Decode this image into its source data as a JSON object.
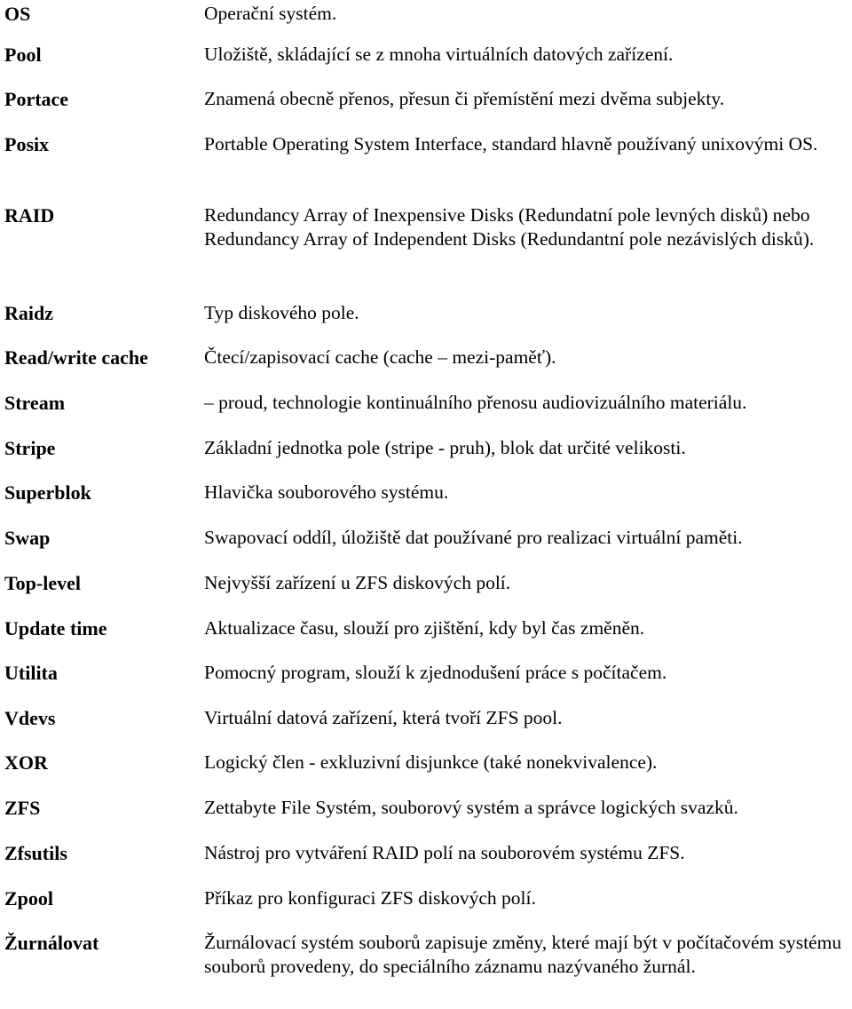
{
  "glossary": {
    "entries": [
      {
        "term": "OS",
        "definition": "Operační systém."
      },
      {
        "term": "Pool",
        "definition": "Uložiště, skládající se z mnoha virtuálních datových zařízení."
      },
      {
        "term": "Portace",
        "definition": "Znamená obecně přenos, přesun či přemístění mezi dvěma subjekty."
      },
      {
        "term": "Posix",
        "definition": "Portable Operating System Interface, standard hlavně používaný unixovými OS."
      },
      {
        "term": "RAID",
        "definition": "Redundancy Array of Inexpensive Disks (Redundatní pole levných disků) nebo Redundancy Array of Independent Disks (Redundantní pole nezávislých disků)."
      },
      {
        "term": "Raidz",
        "definition": "Typ diskového pole."
      },
      {
        "term": "Read/write cache",
        "definition": "Čtecí/zapisovací cache (cache – mezi-paměť)."
      },
      {
        "term": "Stream",
        "definition": " – proud, technologie kontinuálního přenosu audiovizuálního materiálu."
      },
      {
        "term": "Stripe",
        "definition": "Základní jednotka pole (stripe - pruh), blok dat určité velikosti."
      },
      {
        "term": "Superblok",
        "definition": "Hlavička souborového systému."
      },
      {
        "term": "Swap",
        "definition": "Swapovací oddíl, úložiště dat používané pro realizaci virtuální paměti."
      },
      {
        "term": "Top-level",
        "definition": "Nejvyšší zařízení u ZFS diskových polí."
      },
      {
        "term": "Update time",
        "definition": "Aktualizace času, slouží pro zjištění, kdy byl čas změněn."
      },
      {
        "term": "Utilita",
        "definition": "Pomocný program, slouží k zjednodušení práce s počítačem."
      },
      {
        "term": "Vdevs",
        "definition": "Virtuální datová zařízení, která tvoří ZFS pool."
      },
      {
        "term": "XOR",
        "definition": "Logický člen - exkluzivní disjunkce (také nonekvivalence)."
      },
      {
        "term": "ZFS",
        "definition": "Zettabyte File Systém, souborový systém a správce logických svazků."
      },
      {
        "term": "Zfsutils",
        "definition": "Nástroj pro vytváření RAID polí na souborovém systému ZFS."
      },
      {
        "term": "Zpool",
        "definition": "Příkaz pro konfiguraci ZFS diskových polí."
      },
      {
        "term": "Žurnálovat",
        "definition": "Žurnálovací systém souborů zapisuje změny, které mají být v počítačovém systému souborů provedeny, do speciálního záznamu nazývaného žurnál."
      }
    ]
  }
}
